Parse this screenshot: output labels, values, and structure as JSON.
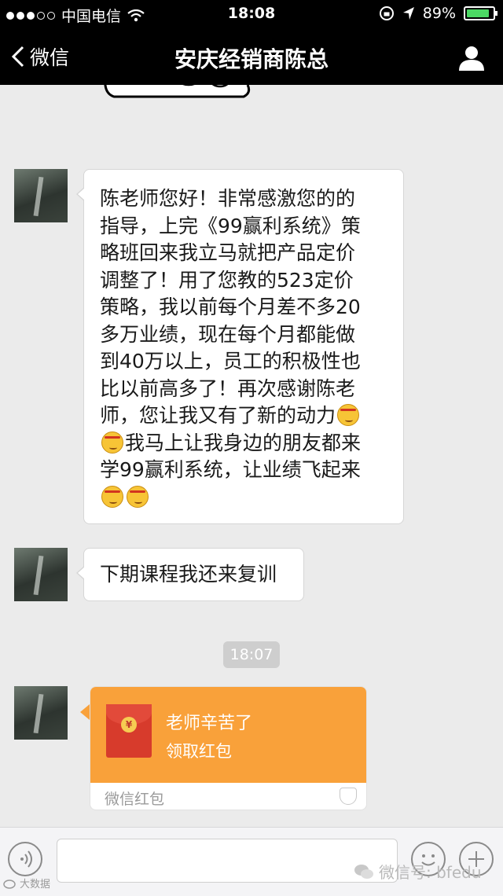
{
  "status_bar": {
    "carrier": "中国电信",
    "time": "18:08",
    "battery_percent": "89%",
    "battery_level": 0.89,
    "battery_color": "#4cd964"
  },
  "nav": {
    "back_label": "微信",
    "title": "安庆经销商陈总",
    "profile_icon": "person-icon"
  },
  "messages": [
    {
      "type": "text",
      "lines": [
        "陈老师您好！非常感激您的的",
        "指导，上完《99赢利系统》策",
        "略班回来我立马就把产品定价",
        "调整了！用了您教的523定价",
        "策略，我以前每个月差不多20",
        "多万业绩，现在每个月都能做",
        "到40万以上，员工的积极性也",
        "比以前高多了！再次感谢陈老",
        "师，您让我又有了新的动力",
        "我马上让我身边的朋友都来",
        "学99赢利系统，让业绩飞起来",
        ""
      ]
    },
    {
      "type": "text",
      "text": "下期课程我还来复训"
    }
  ],
  "timestamp": "18:07",
  "red_packet": {
    "title": "老师辛苦了",
    "action": "领取红包",
    "footer": "微信红包",
    "coin_symbol": "¥",
    "color": "#f9a13a"
  },
  "input_bar": {
    "voice_icon": "voice-icon",
    "emoji_icon": "smiley-icon",
    "plus_icon": "plus-icon"
  },
  "watermark": {
    "left_text": "大数据",
    "right_text": "微信号: bfedu"
  }
}
